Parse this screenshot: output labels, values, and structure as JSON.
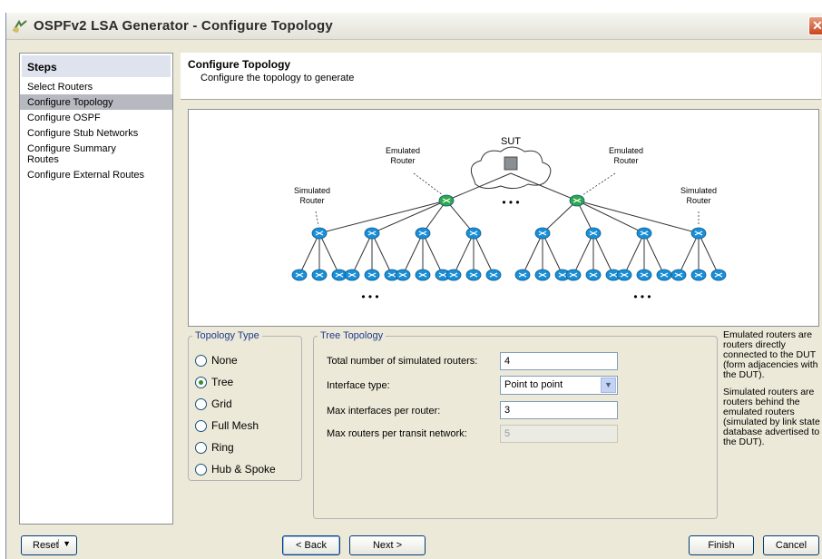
{
  "window": {
    "title": "OSPFv2 LSA Generator - Configure Topology",
    "close_label": "✕"
  },
  "steps": {
    "header": "Steps",
    "items": [
      {
        "label": "Select Routers",
        "active": false
      },
      {
        "label": "Configure Topology",
        "active": true
      },
      {
        "label": "Configure OSPF",
        "active": false
      },
      {
        "label": "Configure Stub Networks",
        "active": false
      },
      {
        "label": "Configure Summary Routes",
        "active": false
      },
      {
        "label": "Configure External Routes",
        "active": false
      }
    ]
  },
  "header": {
    "title": "Configure Topology",
    "subtitle": "Configure the topology to generate"
  },
  "diagram": {
    "sut_label": "SUT",
    "emulated_left": "Emulated Router",
    "emulated_right": "Emulated Router",
    "simulated_left": "Simulated Router",
    "simulated_right": "Simulated Router",
    "ellipsis": "• • •"
  },
  "topology_type": {
    "legend": "Topology Type",
    "options": [
      {
        "label": "None",
        "selected": false
      },
      {
        "label": "Tree",
        "selected": true
      },
      {
        "label": "Grid",
        "selected": false
      },
      {
        "label": "Full Mesh",
        "selected": false
      },
      {
        "label": "Ring",
        "selected": false
      },
      {
        "label": "Hub & Spoke",
        "selected": false
      }
    ]
  },
  "tree_topology": {
    "legend": "Tree Topology",
    "total_routers_label": "Total number of simulated routers:",
    "total_routers_value": "4",
    "interface_type_label": "Interface type:",
    "interface_type_value": "Point to point",
    "max_interfaces_label": "Max interfaces per router:",
    "max_interfaces_value": "3",
    "max_routers_transit_label": "Max routers per transit network:",
    "max_routers_transit_value": "5"
  },
  "help": {
    "emulated": "Emulated routers are routers directly connected to the DUT (form adjacencies with the DUT).",
    "simulated": "Simulated routers are routers behind the emulated routers (simulated by link state database advertised to the DUT)."
  },
  "buttons": {
    "reset": "Reset",
    "back": "< Back",
    "next": "Next >",
    "finish": "Finish",
    "cancel": "Cancel"
  },
  "colors": {
    "router_blue": "#1a8fd8",
    "router_green": "#2fa84a",
    "legend_blue": "#1f3b8f"
  }
}
